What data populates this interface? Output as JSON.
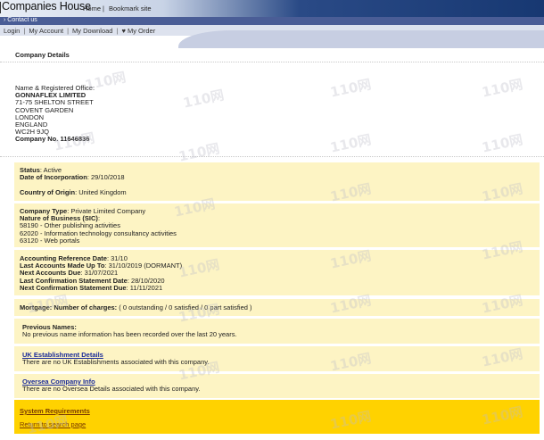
{
  "header": {
    "brand": "Companies House",
    "links": [
      "Home",
      "Bookmark site"
    ],
    "link_separator": "|",
    "subbar_link": "› Contact us"
  },
  "nav": {
    "items": [
      "Login",
      "My Account",
      "My Download",
      "♥ My Order"
    ],
    "separator": "|"
  },
  "section_title": "Company Details",
  "office": {
    "heading": "Name & Registered Office:",
    "name": "GONNAFLEX LIMITED",
    "address_lines": [
      "71-75 SHELTON STREET",
      "COVENT GARDEN",
      "LONDON",
      "ENGLAND",
      "WC2H 9JQ"
    ],
    "company_no_label": "Company No.",
    "company_no": "11646836"
  },
  "status": {
    "status_label": "Status",
    "status_value": ": Active",
    "incorp_label": "Date of Incorporation",
    "incorp_value": ": 29/10/2018",
    "origin_label": "Country of Origin",
    "origin_value": ": United Kingdom"
  },
  "type": {
    "type_label": "Company Type",
    "type_value": ": Private Limited Company",
    "nature_label": "Nature of Business (SIC)",
    "nature_suffix": ":",
    "sic": [
      "58190 - Other publishing activities",
      "62020 - Information technology consultancy activities",
      "63120 - Web portals"
    ]
  },
  "accounts": {
    "ard_label": "Accounting Reference Date",
    "ard_value": ": 31/10",
    "last_label": "Last Accounts Made Up To",
    "last_value": ": 31/10/2019  (DORMANT)",
    "next_label": "Next Accounts Due",
    "next_value": ": 31/07/2021",
    "lcs_label": "Last Confirmation Statement Date",
    "lcs_value": ": 28/10/2020",
    "ncs_label": "Next Confirmation Statement Due",
    "ncs_value": ": 11/11/2021"
  },
  "mortgage": {
    "label": "Mortgage: Number of charges:",
    "value": " ( 0 outstanding / 0 satisfied / 0 part satisfied )"
  },
  "previous_names": {
    "heading": "Previous Names:",
    "text": "No previous name information has been recorded over the last 20 years."
  },
  "uk_establishment": {
    "link": "UK Establishment Details",
    "text": "There are no UK Establishments associated with this company."
  },
  "oversea": {
    "link": "Oversea Company Info",
    "text": "There are no Oversea Details associated with this company."
  },
  "footer": {
    "system_requirements": "System Requirements",
    "return_link": "Return to search page"
  },
  "watermark": "110网"
}
